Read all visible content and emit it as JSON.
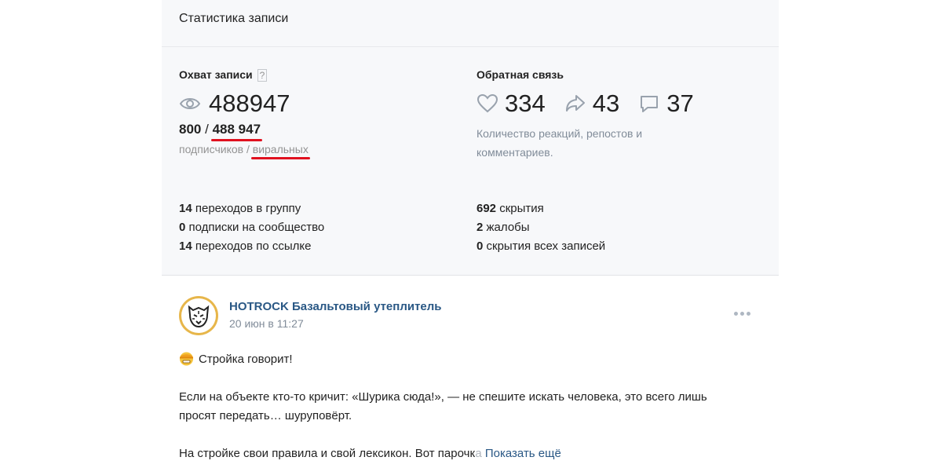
{
  "header": {
    "title": "Статистика записи"
  },
  "reach": {
    "title": "Охват записи",
    "help_label": "?",
    "views": "488947",
    "subscribers": "800",
    "separator": "/",
    "viral": "488 947",
    "subscribers_label": "подписчиков",
    "viral_label": "виральных",
    "stats": [
      {
        "value": "14",
        "label": "переходов в группу"
      },
      {
        "value": "0",
        "label": "подписки на сообщество"
      },
      {
        "value": "14",
        "label": "переходов по ссылке"
      }
    ]
  },
  "feedback": {
    "title": "Обратная связь",
    "likes": "334",
    "reposts": "43",
    "comments": "37",
    "description_line1": "Количество реакций, репостов и",
    "description_line2": "комментариев.",
    "stats": [
      {
        "value": "692",
        "label": "скрытия"
      },
      {
        "value": "2",
        "label": "жалобы"
      },
      {
        "value": "0",
        "label": "скрытия всех записей"
      }
    ]
  },
  "post": {
    "author": "HOTROCK Базальтовый утеплитель",
    "date": "20 июн в 11:27",
    "line1": "Стройка говорит!",
    "line2": "Если на объекте кто-то кричит: «Шурика сюда!», — не спешите искать человека, это всего лишь",
    "line3": "просят передать… шуруповёрт.",
    "line4": "На стройке свои правила и свой лексикон. Вот парочк",
    "line4_fade": "а",
    "show_more": "Показать ещё"
  },
  "colors": {
    "accent_link": "#2a5885",
    "underline_red": "#e0111f",
    "muted": "#939393",
    "panel_bg": "#f7f8fa"
  }
}
